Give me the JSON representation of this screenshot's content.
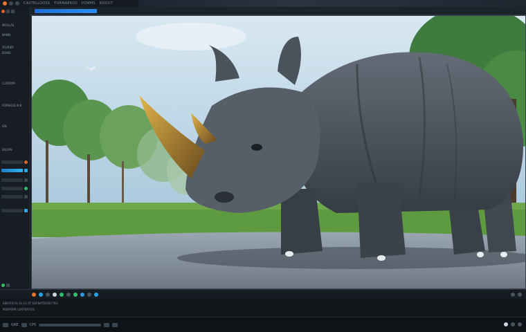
{
  "menubar": {
    "items": [
      "CASTELLOOSS",
      "TORMAEROS",
      "POMMS",
      "ROOUT"
    ]
  },
  "toolbar2": {
    "items": [
      "",
      ""
    ]
  },
  "leftpanel": {
    "labels": [
      "MOOLAS",
      "NAMN",
      "ATURIEP",
      "BONIS",
      "CLOORIM",
      "ROREIGIS ALB",
      "SIN",
      "BIOUPE"
    ]
  },
  "statusbar": {
    "line1": "EBEATICOL OL LS AT SOCNATDOISCTRO",
    "line2": "MSMPSPR  CENTRATIOS"
  },
  "bottombar": {
    "left_label": "GRE",
    "mid_label": "CPS"
  },
  "scene": {
    "subject": "rhinoceros-statue",
    "colors": {
      "sky": "#b9d3e6",
      "grass": "#5e9a3f",
      "road": "#7c8794",
      "rhino": "#4d5560",
      "horn": "#b8892a"
    }
  }
}
